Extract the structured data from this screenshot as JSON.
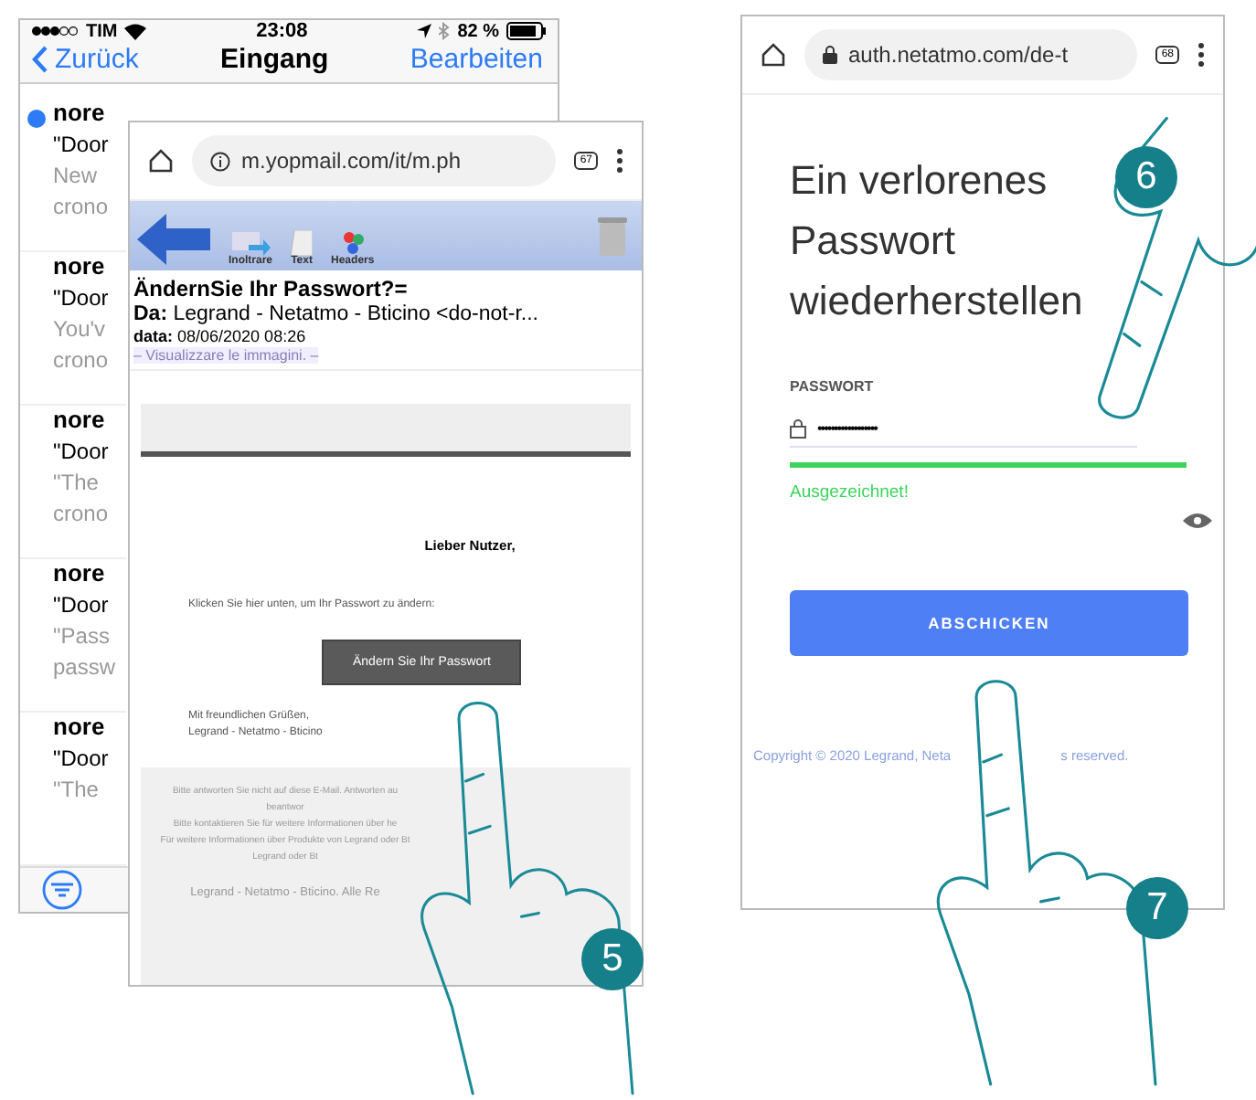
{
  "mail_app": {
    "status_bar": {
      "carrier": "TIM",
      "time": "23:08",
      "battery": "82 %"
    },
    "nav": {
      "back": "Zurück",
      "title": "Eingang",
      "action": "Bearbeiten"
    },
    "messages": [
      {
        "sender": "nore",
        "subject": "\"Door",
        "line_1": "New",
        "line_2": "crono",
        "unread": true
      },
      {
        "sender": "nore",
        "subject": "\"Door",
        "line_1": "You'v",
        "line_2": "crono",
        "unread": false
      },
      {
        "sender": "nore",
        "subject": "\"Door",
        "line_1": "\"The",
        "line_2": "crono",
        "unread": false
      },
      {
        "sender": "nore",
        "subject": "\"Door",
        "line_1": "\"Pass",
        "line_2": "passw",
        "unread": false
      },
      {
        "sender": "nore",
        "subject": "\"Door",
        "line_1": "\"The",
        "unread": false
      }
    ]
  },
  "email_browser": {
    "url": "m.yopmail.com/it/m.ph",
    "tab_count": "67",
    "toolbar": [
      {
        "kind": "forward",
        "label": "Inoltrare"
      },
      {
        "kind": "text",
        "label": "Text"
      },
      {
        "kind": "headers",
        "label": "Headers"
      }
    ],
    "subject": "ÄndernSie Ihr Passwort?=",
    "from": "**Da:** Legrand - Netatmo - Bticino <do-not-r...",
    "date": "**data:** 08/06/2020 08:26",
    "images_link": "– Visualizzare le immagini. –",
    "greeting": "Lieber Nutzer,",
    "instruction": "Klicken Sie hier unten, um Ihr Passwort zu ändern:",
    "button": "Ändern Sie Ihr Passwort",
    "closing": [
      "Mit freundlichen Grüßen,",
      "Legrand - Netatmo - Bticino"
    ],
    "footer": [
      "Bitte antworten Sie nicht auf diese E-Mail. Antworten au",
      "beantwor",
      "Bitte kontaktieren Sie für weitere Informationen über he",
      "Für weitere Informationen über Produkte von Legrand oder Bt",
      "Legrand oder Bt"
    ],
    "footer_brand": "Legrand - Netatmo - Bticino. Alle Re"
  },
  "reset_page": {
    "url": "auth.netatmo.com/de-t",
    "tab_count": "68",
    "heading": [
      "Ein verlorenes",
      "Passwort",
      "wiederherstellen"
    ],
    "field_label": "PASSWORT",
    "password": "••••••••••••••••••",
    "strength": {
      "level": 1,
      "label": "Ausgezeichnet!"
    },
    "button": "ABSCHICKEN",
    "copyright": [
      "Copyright © 2020 Legrand, Neta",
      "s reserved."
    ]
  },
  "steps": [
    "5",
    "6",
    "7"
  ]
}
